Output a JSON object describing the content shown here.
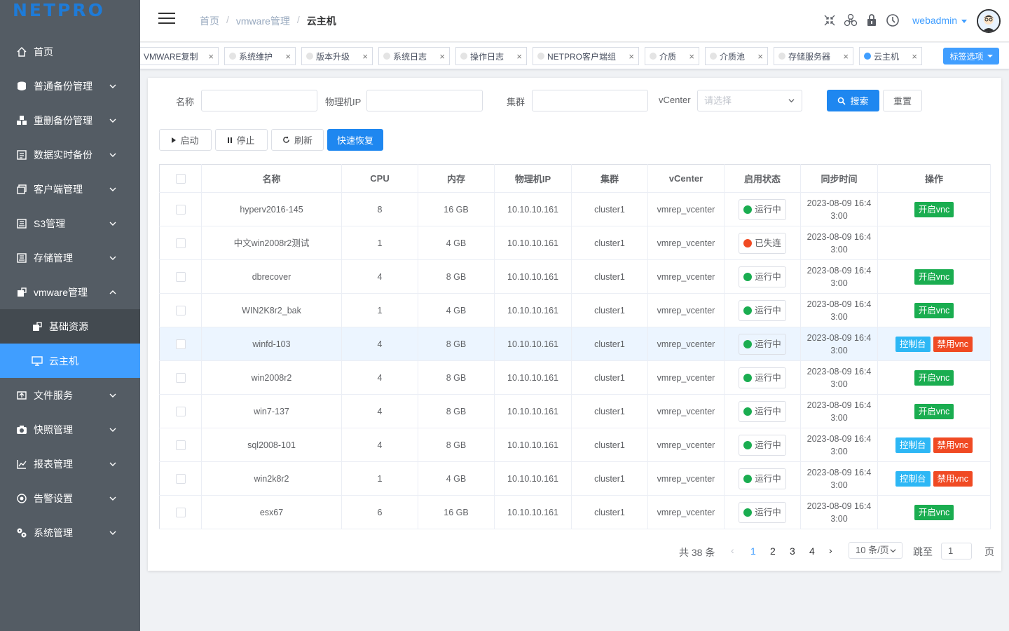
{
  "app": {
    "logo": "NETPRO"
  },
  "sidebar": {
    "items": [
      {
        "label": "首页",
        "icon": "home-icon"
      },
      {
        "label": "普通备份管理",
        "icon": "database-icon"
      },
      {
        "label": "重删备份管理",
        "icon": "cubes-icon"
      },
      {
        "label": "数据实时备份",
        "icon": "document-icon"
      },
      {
        "label": "客户端管理",
        "icon": "windows-icon"
      },
      {
        "label": "S3管理",
        "icon": "server-icon"
      },
      {
        "label": "存储管理",
        "icon": "storage-icon"
      },
      {
        "label": "vmware管理",
        "icon": "vm-icon"
      },
      {
        "label": "文件服务",
        "icon": "file-service-icon"
      },
      {
        "label": "快照管理",
        "icon": "camera-icon"
      },
      {
        "label": "报表管理",
        "icon": "chart-icon"
      },
      {
        "label": "告警设置",
        "icon": "alarm-icon"
      },
      {
        "label": "系统管理",
        "icon": "settings-icon"
      }
    ],
    "submenu": [
      {
        "label": "基础资源",
        "icon": "resource-icon"
      },
      {
        "label": "云主机",
        "icon": "monitor-icon"
      }
    ]
  },
  "header": {
    "breadcrumb": [
      "首页",
      "vmware管理",
      "云主机"
    ],
    "user": "webadmin"
  },
  "tags": {
    "items": [
      "VMWARE复制",
      "系统维护",
      "版本升级",
      "系统日志",
      "操作日志",
      "NETPRO客户端组",
      "介质",
      "介质池",
      "存储服务器",
      "云主机"
    ],
    "options_label": "标签选项"
  },
  "filters": {
    "name_label": "名称",
    "ip_label": "物理机IP",
    "cluster_label": "集群",
    "vcenter_label": "vCenter",
    "vcenter_placeholder": "请选择",
    "search_label": "搜索",
    "reset_label": "重置"
  },
  "actions": {
    "start": "启动",
    "stop": "停止",
    "refresh": "刷新",
    "quick_restore": "快速恢复"
  },
  "table": {
    "columns": [
      "名称",
      "CPU",
      "内存",
      "物理机IP",
      "集群",
      "vCenter",
      "启用状态",
      "同步时间",
      "操作"
    ],
    "rows": [
      {
        "name": "hyperv2016-145",
        "cpu": "8",
        "mem": "16 GB",
        "ip": "10.10.10.161",
        "cluster": "cluster1",
        "vcenter": "vmrep_vcenter",
        "status": "运行中",
        "time1": "2023-08-09 16:4",
        "time2": "3:00",
        "ops": [
          "开启vnc"
        ]
      },
      {
        "name": "中文win2008r2测试",
        "cpu": "1",
        "mem": "4 GB",
        "ip": "10.10.10.161",
        "cluster": "cluster1",
        "vcenter": "vmrep_vcenter",
        "status": "已失连",
        "time1": "2023-08-09 16:4",
        "time2": "3:00",
        "ops": []
      },
      {
        "name": "dbrecover",
        "cpu": "4",
        "mem": "8 GB",
        "ip": "10.10.10.161",
        "cluster": "cluster1",
        "vcenter": "vmrep_vcenter",
        "status": "运行中",
        "time1": "2023-08-09 16:4",
        "time2": "3:00",
        "ops": [
          "开启vnc"
        ]
      },
      {
        "name": "WIN2K8r2_bak",
        "cpu": "1",
        "mem": "4 GB",
        "ip": "10.10.10.161",
        "cluster": "cluster1",
        "vcenter": "vmrep_vcenter",
        "status": "运行中",
        "time1": "2023-08-09 16:4",
        "time2": "3:00",
        "ops": [
          "开启vnc"
        ]
      },
      {
        "name": "winfd-103",
        "cpu": "4",
        "mem": "8 GB",
        "ip": "10.10.10.161",
        "cluster": "cluster1",
        "vcenter": "vmrep_vcenter",
        "status": "运行中",
        "time1": "2023-08-09 16:4",
        "time2": "3:00",
        "ops": [
          "控制台",
          "禁用vnc"
        ]
      },
      {
        "name": "win2008r2",
        "cpu": "4",
        "mem": "8 GB",
        "ip": "10.10.10.161",
        "cluster": "cluster1",
        "vcenter": "vmrep_vcenter",
        "status": "运行中",
        "time1": "2023-08-09 16:4",
        "time2": "3:00",
        "ops": [
          "开启vnc"
        ]
      },
      {
        "name": "win7-137",
        "cpu": "4",
        "mem": "8 GB",
        "ip": "10.10.10.161",
        "cluster": "cluster1",
        "vcenter": "vmrep_vcenter",
        "status": "运行中",
        "time1": "2023-08-09 16:4",
        "time2": "3:00",
        "ops": [
          "开启vnc"
        ]
      },
      {
        "name": "sql2008-101",
        "cpu": "4",
        "mem": "8 GB",
        "ip": "10.10.10.161",
        "cluster": "cluster1",
        "vcenter": "vmrep_vcenter",
        "status": "运行中",
        "time1": "2023-08-09 16:4",
        "time2": "3:00",
        "ops": [
          "控制台",
          "禁用vnc"
        ]
      },
      {
        "name": "win2k8r2",
        "cpu": "1",
        "mem": "4 GB",
        "ip": "10.10.10.161",
        "cluster": "cluster1",
        "vcenter": "vmrep_vcenter",
        "status": "运行中",
        "time1": "2023-08-09 16:4",
        "time2": "3:00",
        "ops": [
          "控制台",
          "禁用vnc"
        ]
      },
      {
        "name": "esx67",
        "cpu": "6",
        "mem": "16 GB",
        "ip": "10.10.10.161",
        "cluster": "cluster1",
        "vcenter": "vmrep_vcenter",
        "status": "运行中",
        "time1": "2023-08-09 16:4",
        "time2": "3:00",
        "ops": [
          "开启vnc"
        ]
      }
    ]
  },
  "pager": {
    "total": "共 38 条",
    "pages": [
      "1",
      "2",
      "3",
      "4"
    ],
    "current": "1",
    "size": "10 条/页",
    "goto": "跳至",
    "goto_value": "1",
    "unit": "页"
  },
  "colors": {
    "accent": "#409eff",
    "running": "#1aad50",
    "lost": "#f04a23",
    "sidebar": "#545c64"
  }
}
